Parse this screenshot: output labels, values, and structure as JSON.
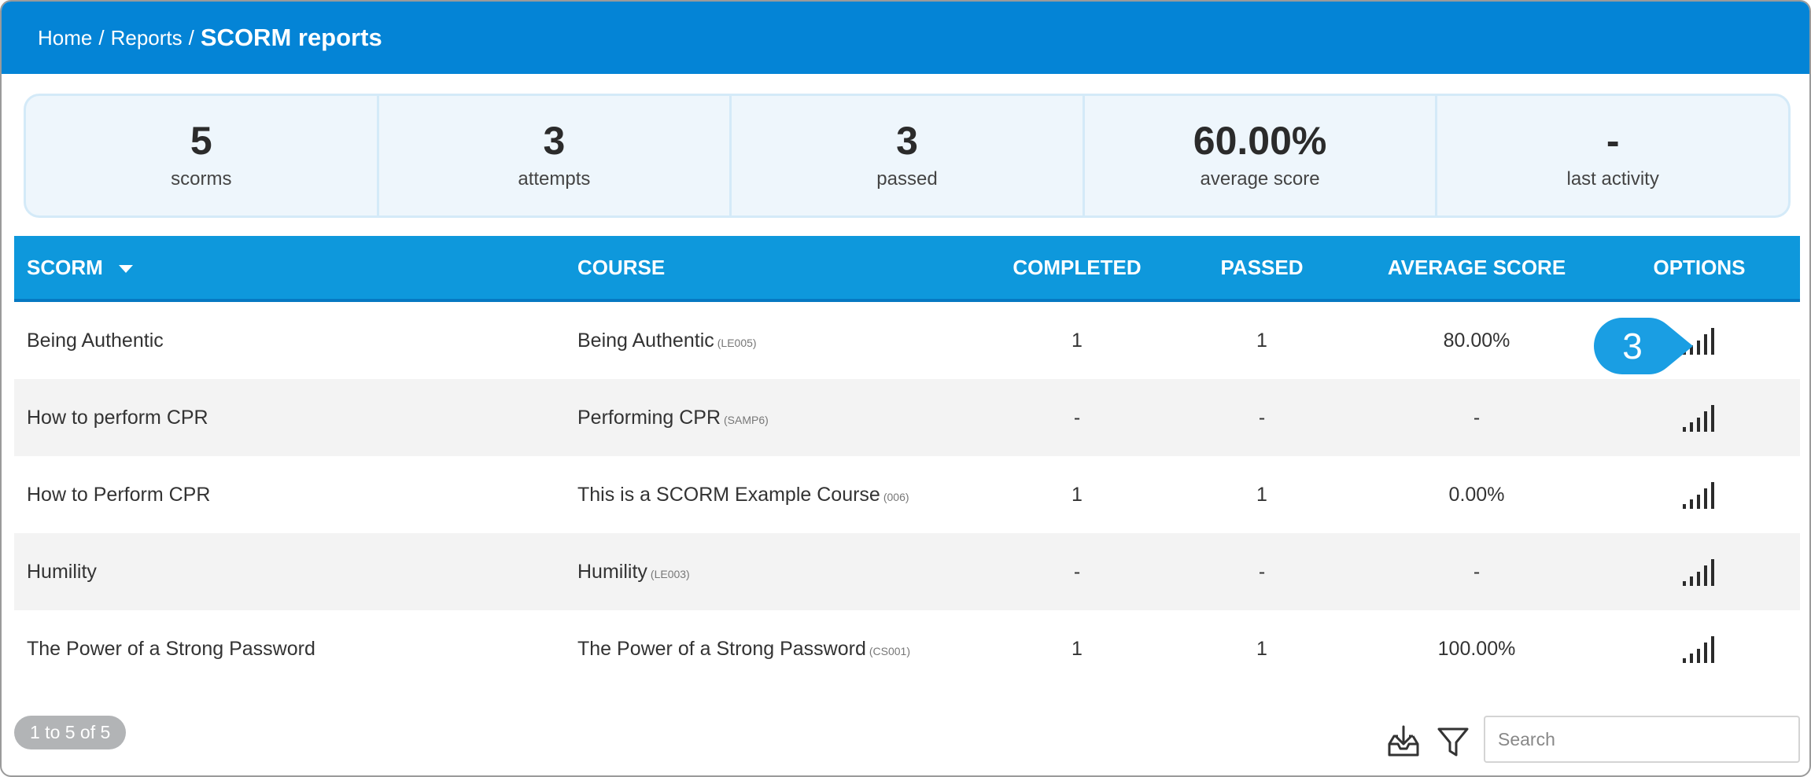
{
  "breadcrumb": {
    "home": "Home",
    "reports": "Reports",
    "separator": "/",
    "current": "SCORM reports"
  },
  "stats": [
    {
      "value": "5",
      "label": "scorms"
    },
    {
      "value": "3",
      "label": "attempts"
    },
    {
      "value": "3",
      "label": "passed"
    },
    {
      "value": "60.00%",
      "label": "average score"
    },
    {
      "value": "-",
      "label": "last activity"
    }
  ],
  "table": {
    "headers": {
      "scorm": "SCORM",
      "course": "COURSE",
      "completed": "COMPLETED",
      "passed": "PASSED",
      "average_score": "AVERAGE SCORE",
      "options": "OPTIONS"
    },
    "rows": [
      {
        "scorm": "Being Authentic",
        "course": "Being Authentic",
        "code": "(LE005)",
        "completed": "1",
        "passed": "1",
        "average_score": "80.00%"
      },
      {
        "scorm": "How to perform CPR",
        "course": "Performing CPR",
        "code": "(SAMP6)",
        "completed": "-",
        "passed": "-",
        "average_score": "-"
      },
      {
        "scorm": "How to Perform CPR",
        "course": "This is a SCORM Example Course",
        "code": "(006)",
        "completed": "1",
        "passed": "1",
        "average_score": "0.00%"
      },
      {
        "scorm": "Humility",
        "course": "Humility",
        "code": "(LE003)",
        "completed": "-",
        "passed": "-",
        "average_score": "-"
      },
      {
        "scorm": "The Power of a Strong Password",
        "course": "The Power of a Strong Password",
        "code": "(CS001)",
        "completed": "1",
        "passed": "1",
        "average_score": "100.00%"
      }
    ]
  },
  "callout": {
    "number": "3"
  },
  "pager": {
    "text": "1 to 5 of 5"
  },
  "search": {
    "placeholder": "Search"
  },
  "icons": {
    "options": "stats-bars-icon",
    "download": "download-icon",
    "filter": "filter-icon"
  },
  "colors": {
    "header_bar": "#0484d6",
    "table_header": "#0e98dc",
    "stats_bg": "#eef6fc",
    "callout": "#1a9ee3"
  }
}
